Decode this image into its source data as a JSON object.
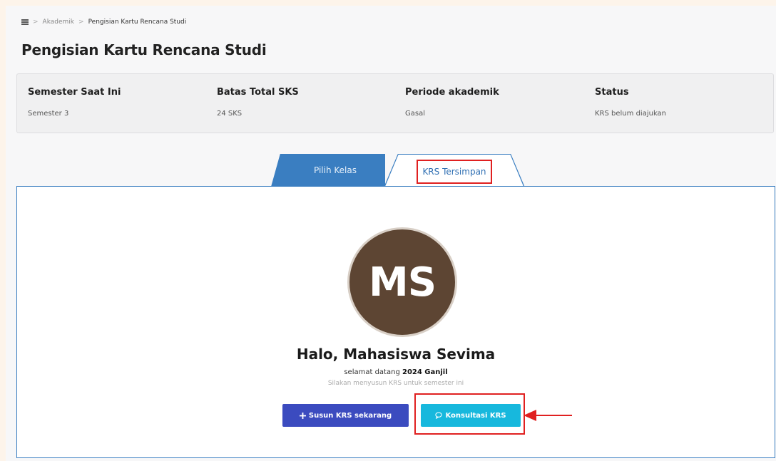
{
  "breadcrumb": {
    "items": [
      "Akademik",
      "Pengisian Kartu Rencana Studi"
    ],
    "separator": ">"
  },
  "page_title": "Pengisian Kartu Rencana Studi",
  "info": [
    {
      "label": "Semester Saat Ini",
      "value": "Semester 3"
    },
    {
      "label": "Batas Total SKS",
      "value": "24 SKS"
    },
    {
      "label": "Periode akademik",
      "value": "Gasal"
    },
    {
      "label": "Status",
      "value": "KRS belum diajukan"
    }
  ],
  "tabs": [
    {
      "label": "Pilih Kelas",
      "active": false
    },
    {
      "label": "KRS Tersimpan",
      "active": true
    }
  ],
  "profile": {
    "initials": "MS",
    "greeting": "Halo, Mahasiswa Sevima",
    "welcome_prefix": "selamat datang",
    "welcome_period": "2024 Ganjil",
    "hint": "Silakan menyusun KRS untuk semester ini"
  },
  "actions": {
    "susun_icon": "plus-icon",
    "susun_label": "Susun KRS sekarang",
    "konsul_icon": "chat-bubble-icon",
    "konsul_label": "Konsultasi KRS"
  },
  "colors": {
    "primary_tab": "#3a7ec1",
    "susun_button": "#3b4bbf",
    "konsul_button": "#17b8dd",
    "avatar": "#5d4533",
    "annotation": "#e02020"
  }
}
